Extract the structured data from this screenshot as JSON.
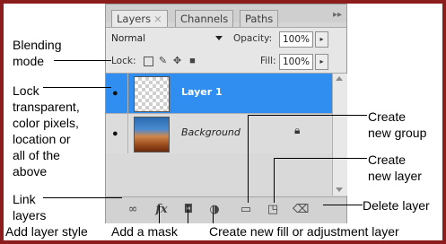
{
  "panel": {
    "tabs": [
      {
        "label": "Layers",
        "close": "×",
        "active": true
      },
      {
        "label": "Channels",
        "active": false
      },
      {
        "label": "Paths",
        "active": false
      }
    ],
    "menu_glyph": "▸▸",
    "blend_mode": "Normal",
    "opacity_label": "Opacity:",
    "opacity_value": "100%",
    "lock_label": "Lock:",
    "fill_label": "Fill:",
    "fill_value": "100%",
    "layers": [
      {
        "name": "Layer 1",
        "selected": true
      },
      {
        "name": "Background",
        "selected": false,
        "locked": true
      }
    ],
    "bottom_icons": [
      "link-icon",
      "fx-icon",
      "mask-icon",
      "adjustment-icon",
      "folder-icon",
      "new-layer-icon",
      "trash-icon"
    ]
  },
  "annotations": {
    "blending_mode": [
      "Blending",
      "mode"
    ],
    "lock": [
      "Lock",
      "transparent,",
      "color pixels,",
      "location or",
      "all of the",
      "above"
    ],
    "link_layers": [
      "Link",
      "layers"
    ],
    "add_layer_style": "Add layer style",
    "add_mask": "Add a mask",
    "new_fill": "Create new fill or adjustment layer",
    "new_group": [
      "Create",
      "new group"
    ],
    "new_layer": [
      "Create",
      "new layer"
    ],
    "delete_layer": "Delete layer"
  },
  "colors": {
    "frame": "#8b1d1d",
    "selection": "#2f8ef0",
    "panel": "#d6d6d6"
  }
}
